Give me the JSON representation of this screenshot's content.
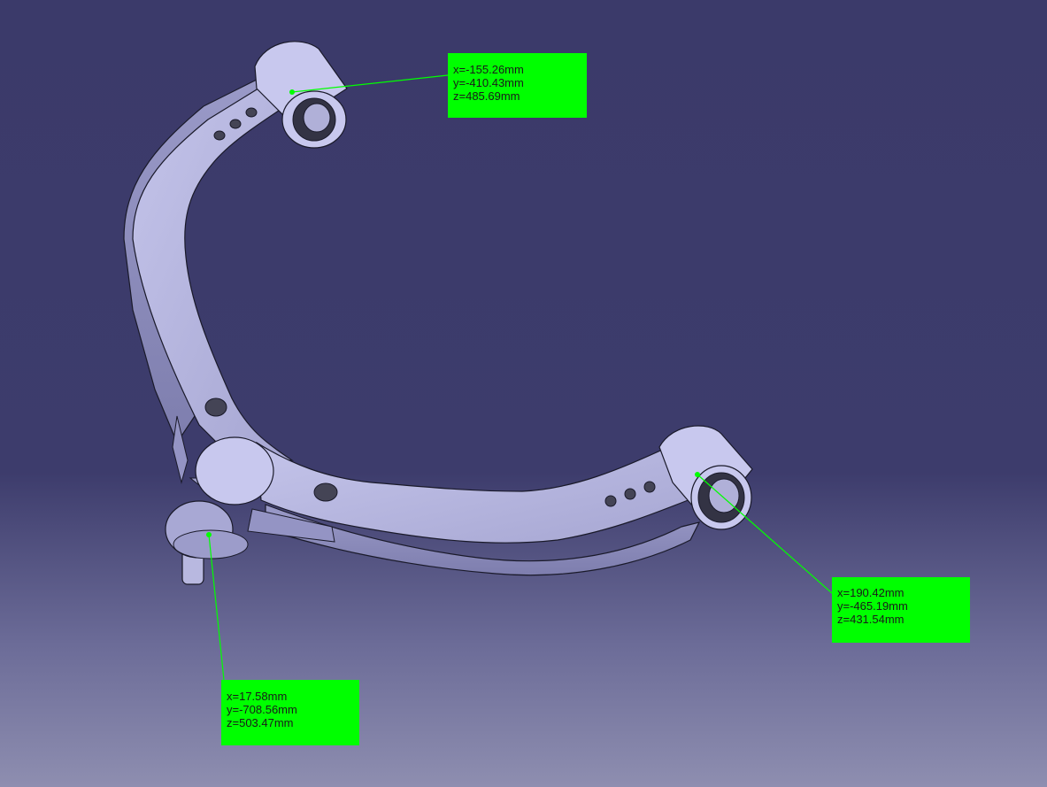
{
  "viewport": {
    "background_top": "#3b3a6a",
    "background_bottom": "#8e8eb0",
    "part_color": "#b4b4dc",
    "edge_color": "#1a1a2a",
    "leader_color": "#00ff00"
  },
  "annotations": [
    {
      "id": "top",
      "x": "x=-155.26mm",
      "y": "y=-410.43mm",
      "z": "z=485.69mm"
    },
    {
      "id": "right",
      "x": "x=190.42mm",
      "y": "y=-465.19mm",
      "z": "z=431.54mm"
    },
    {
      "id": "bottom",
      "x": "x=17.58mm",
      "y": "y=-708.56mm",
      "z": "z=503.47mm"
    }
  ]
}
